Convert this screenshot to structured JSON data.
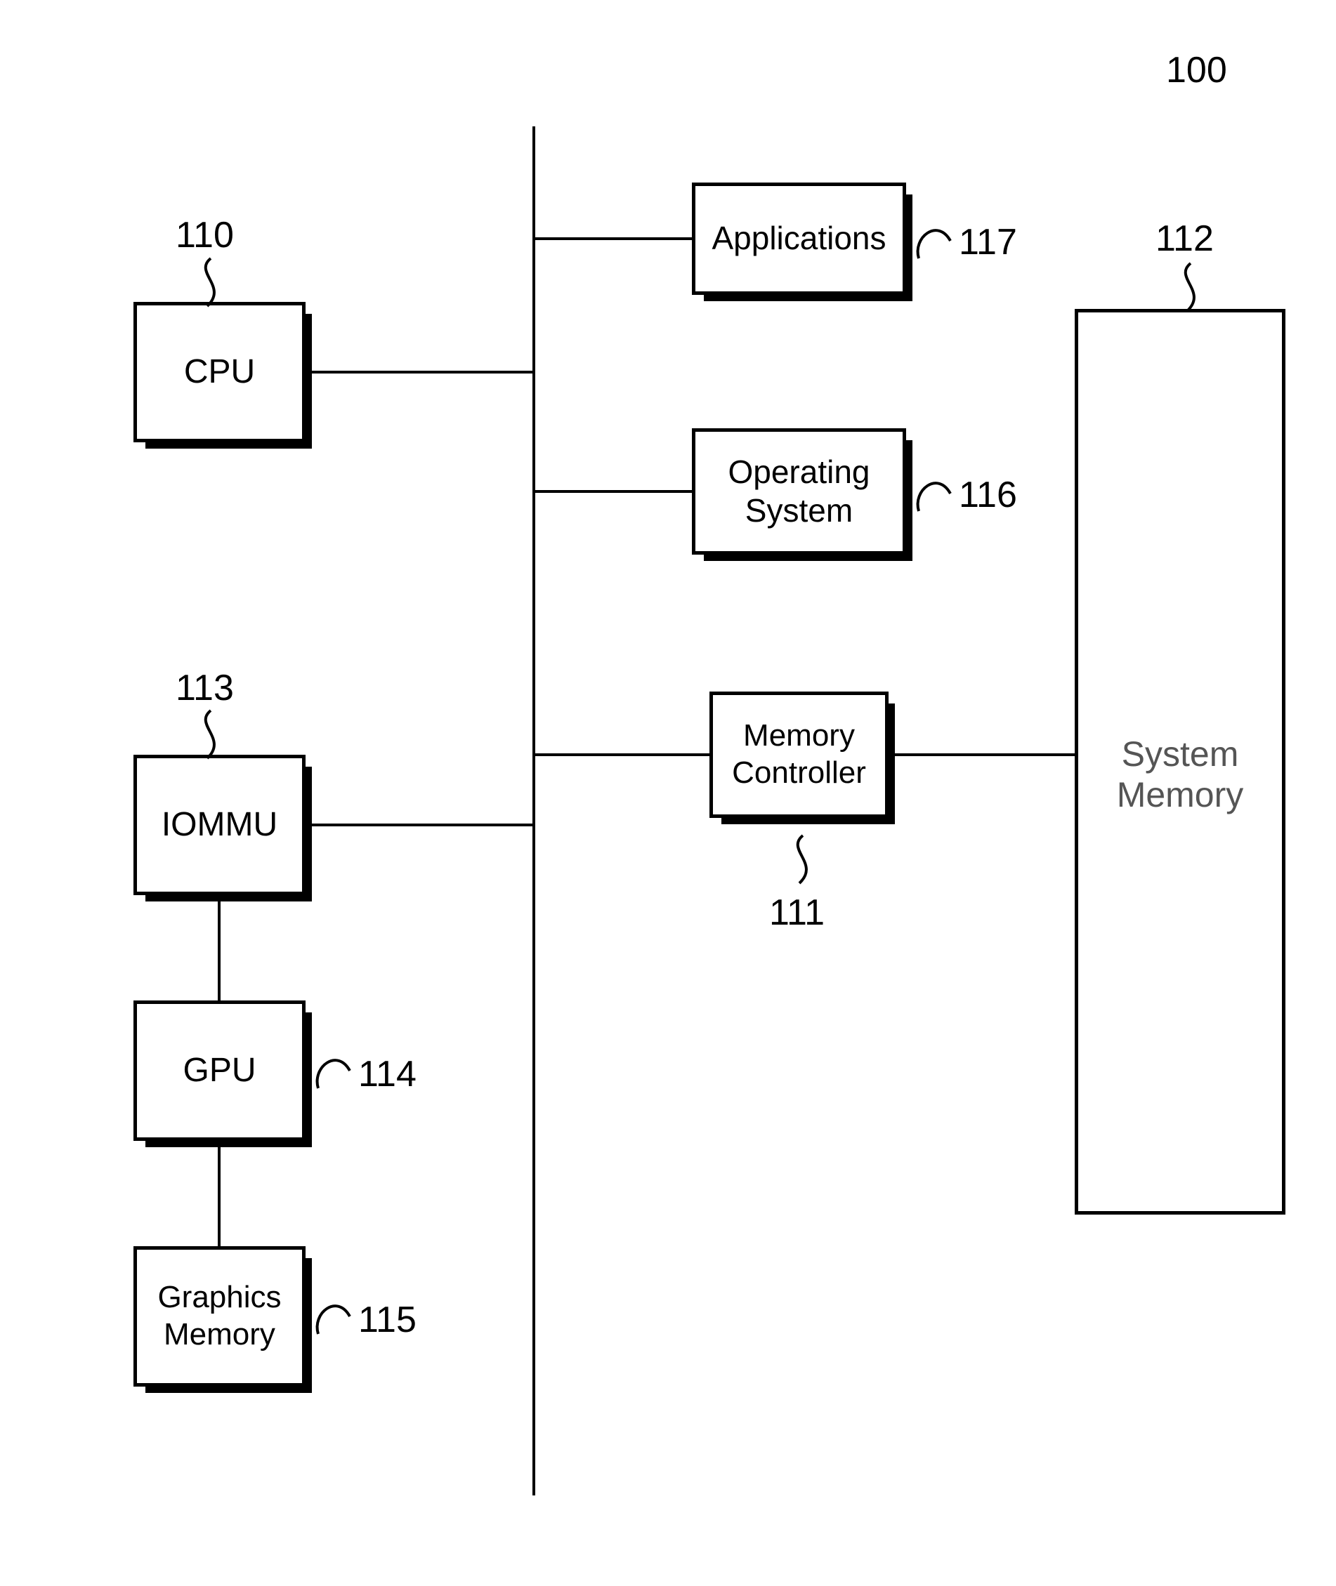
{
  "title_ref": "100",
  "boxes": {
    "cpu": {
      "label": "CPU",
      "ref": "110"
    },
    "iommu": {
      "label": "IOMMU",
      "ref": "113"
    },
    "gpu": {
      "label": "GPU",
      "ref": "114"
    },
    "gmem": {
      "label": "Graphics\nMemory",
      "ref": "115"
    },
    "apps": {
      "label": "Applications",
      "ref": "117"
    },
    "os": {
      "label": "Operating\nSystem",
      "ref": "116"
    },
    "memctl": {
      "label": "Memory\nController",
      "ref": "111"
    },
    "sysmem": {
      "label": "System\nMemory",
      "ref": "112"
    }
  }
}
